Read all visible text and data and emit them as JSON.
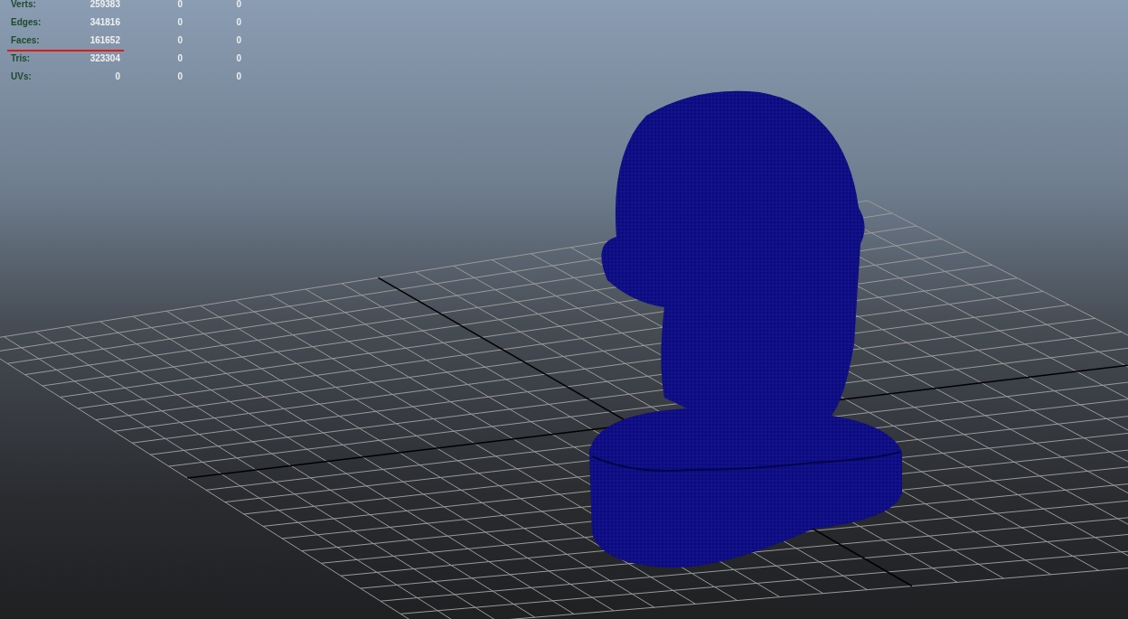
{
  "hud": {
    "rows": [
      {
        "label": "Verts:",
        "value": "259383",
        "column_3": "0",
        "column_4": "0",
        "highlighted": false
      },
      {
        "label": "Edges:",
        "value": "341816",
        "column_3": "0",
        "column_4": "0",
        "highlighted": false
      },
      {
        "label": "Faces:",
        "value": "161652",
        "column_3": "0",
        "column_4": "0",
        "highlighted": true
      },
      {
        "label": "Tris:",
        "value": "323304",
        "column_3": "0",
        "column_4": "0",
        "highlighted": false
      },
      {
        "label": "UVs:",
        "value": "0",
        "column_3": "0",
        "column_4": "0",
        "highlighted": false
      }
    ]
  }
}
